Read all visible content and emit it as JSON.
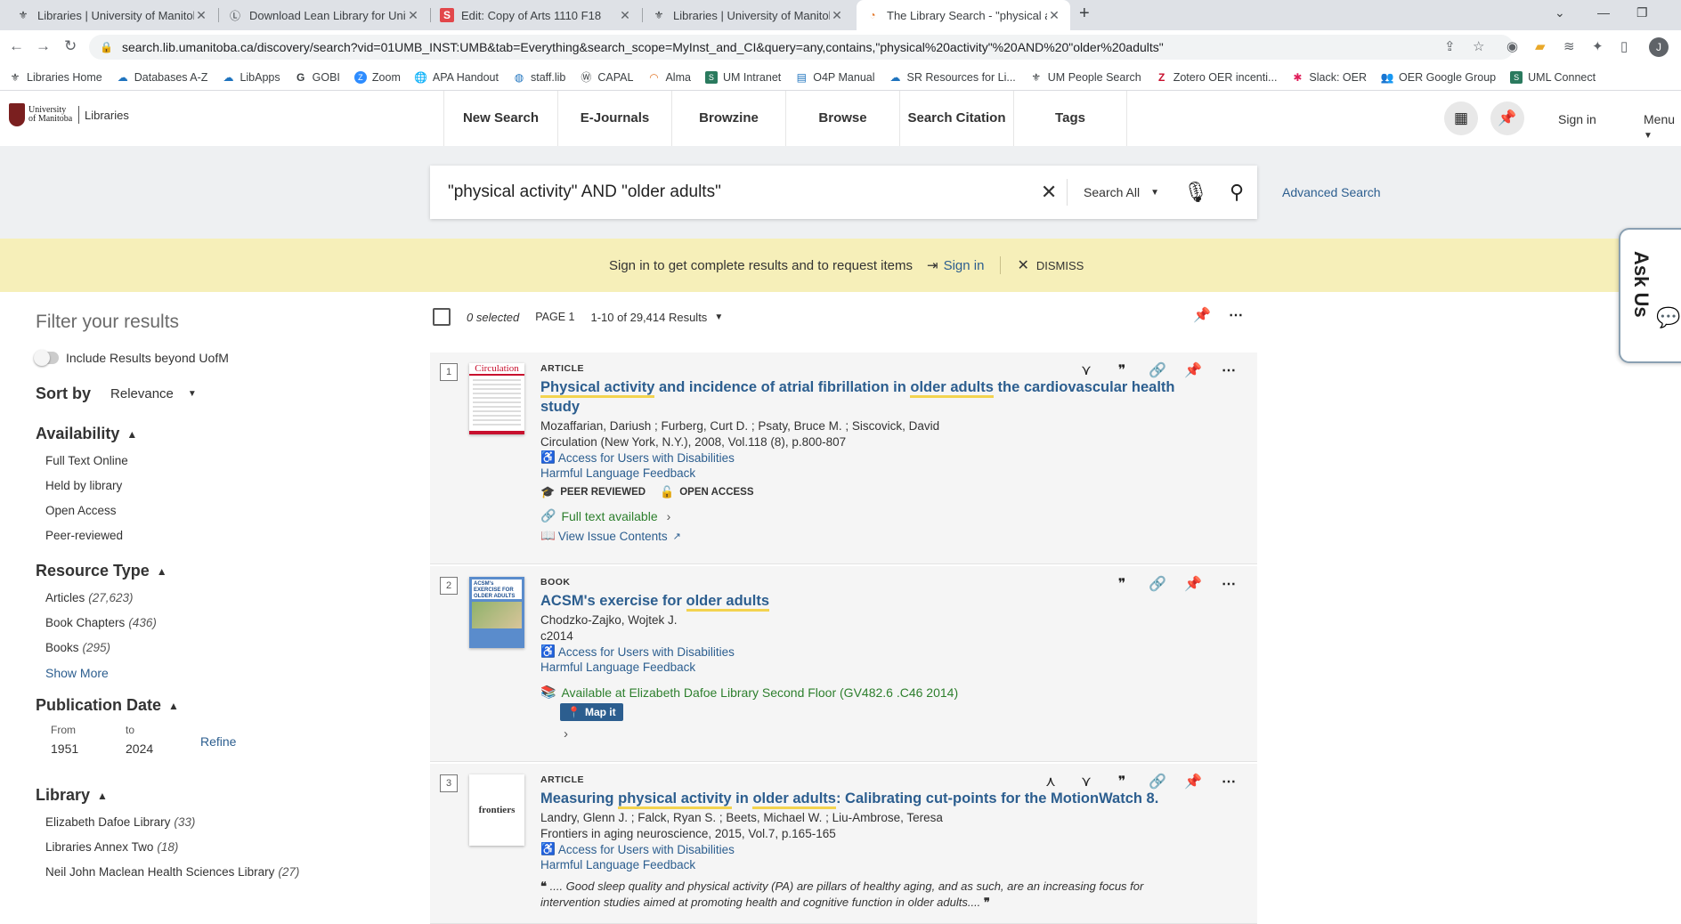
{
  "browser": {
    "tabs": [
      {
        "title": "Libraries | University of Manitoba",
        "icon": "umanitoba-favicon"
      },
      {
        "title": "Download Lean Library for University",
        "icon": "lean-library-favicon"
      },
      {
        "title": "Edit: Copy of Arts 1110 F18",
        "icon": "s-favicon"
      },
      {
        "title": "Libraries | University of Manitoba",
        "icon": "umanitoba-favicon"
      },
      {
        "title": "The Library Search - \"physical act",
        "icon": "primo-favicon"
      }
    ],
    "url": "search.lib.umanitoba.ca/discovery/search?vid=01UMB_INST:UMB&tab=Everything&search_scope=MyInst_and_CI&query=any,contains,\"physical%20activity\"%20AND%20\"older%20adults\"",
    "profile_initial": "J",
    "bookmarks": [
      "Libraries Home",
      "Databases A-Z",
      "LibApps",
      "GOBI",
      "Zoom",
      "APA Handout",
      "staff.lib",
      "CAPAL",
      "Alma",
      "UM Intranet",
      "O4P Manual",
      "SR Resources for Li...",
      "UM People Search",
      "Zotero OER incenti...",
      "Slack: OER",
      "OER Google Group",
      "UML Connect"
    ]
  },
  "header": {
    "logo_university": "University of Manitoba",
    "logo_libraries": "Libraries",
    "nav": [
      "New Search",
      "E-Journals",
      "Browzine",
      "Browse",
      "Search Citation",
      "Tags"
    ],
    "sign_in": "Sign in",
    "menu": "Menu"
  },
  "search": {
    "query": "\"physical activity\" AND \"older adults\"",
    "scope": "Search All",
    "advanced": "Advanced Search"
  },
  "banner": {
    "message": "Sign in to get complete results and to request items",
    "sign_in": "Sign in",
    "dismiss": "DISMISS"
  },
  "askus": "Ask Us",
  "filters": {
    "title": "Filter your results",
    "include_beyond": "Include Results beyond UofM",
    "sort_label": "Sort by",
    "sort_value": "Relevance",
    "availability": {
      "title": "Availability",
      "items": [
        "Full Text Online",
        "Held by library",
        "Open Access",
        "Peer-reviewed"
      ]
    },
    "resource_type": {
      "title": "Resource Type",
      "items": [
        {
          "label": "Articles",
          "count": "(27,623)"
        },
        {
          "label": "Book Chapters",
          "count": "(436)"
        },
        {
          "label": "Books",
          "count": "(295)"
        }
      ],
      "show_more": "Show More"
    },
    "publication_date": {
      "title": "Publication Date",
      "from_label": "From",
      "to_label": "to",
      "from": "1951",
      "to": "2024",
      "refine": "Refine"
    },
    "library": {
      "title": "Library",
      "items": [
        {
          "label": "Elizabeth Dafoe Library",
          "count": "(33)"
        },
        {
          "label": "Libraries Annex Two",
          "count": "(18)"
        },
        {
          "label": "Neil John Maclean Health Sciences Library",
          "count": "(27)"
        }
      ]
    }
  },
  "results_header": {
    "selected": "0 selected",
    "page": "PAGE 1",
    "range": "1-10 of 29,414 Results"
  },
  "results": [
    {
      "num": "1",
      "type": "ARTICLE",
      "title_parts": [
        "Physical activity",
        " and incidence of atrial fibrillation in ",
        "older adults",
        " the cardiovascular health study"
      ],
      "authors": "Mozaffarian, Dariush ; Furberg, Curt D. ; Psaty, Bruce M. ; Siscovick, David",
      "source": "Circulation (New York, N.Y.), 2008, Vol.118 (8), p.800-807",
      "accessibility": "Access for Users with Disabilities",
      "harmful": "Harmful Language Feedback",
      "peer": "PEER REVIEWED",
      "open": "OPEN ACCESS",
      "fulltext": "Full text available",
      "issue": "View Issue Contents",
      "thumb_label": "Circulation"
    },
    {
      "num": "2",
      "type": "BOOK",
      "title_parts": [
        "ACSM's exercise for ",
        "older adults"
      ],
      "authors": "Chodzko-Zajko, Wojtek J.",
      "source": "c2014",
      "accessibility": "Access for Users with Disabilities",
      "harmful": "Harmful Language Feedback",
      "availability": "Available at Elizabeth Dafoe Library  Second Floor (GV482.6 .C46 2014)",
      "mapit": "Map it",
      "thumb_label": "ACSM's EXERCISE FOR OLDER ADULTS"
    },
    {
      "num": "3",
      "type": "ARTICLE",
      "title_parts": [
        "Measuring ",
        "physical activity",
        " in ",
        "older adults",
        ": Calibrating cut-points for the MotionWatch 8."
      ],
      "authors": "Landry, Glenn J. ; Falck, Ryan S. ; Beets, Michael W. ; Liu-Ambrose, Teresa",
      "source": "Frontiers in aging neuroscience, 2015, Vol.7, p.165-165",
      "accessibility": "Access for Users with Disabilities",
      "harmful": "Harmful Language Feedback",
      "snippet": ".... Good sleep quality and physical activity (PA) are pillars of healthy aging, and as such, are an increasing focus for intervention studies aimed at promoting health and cognitive function in older adults....",
      "thumb_label": "frontiers"
    }
  ]
}
